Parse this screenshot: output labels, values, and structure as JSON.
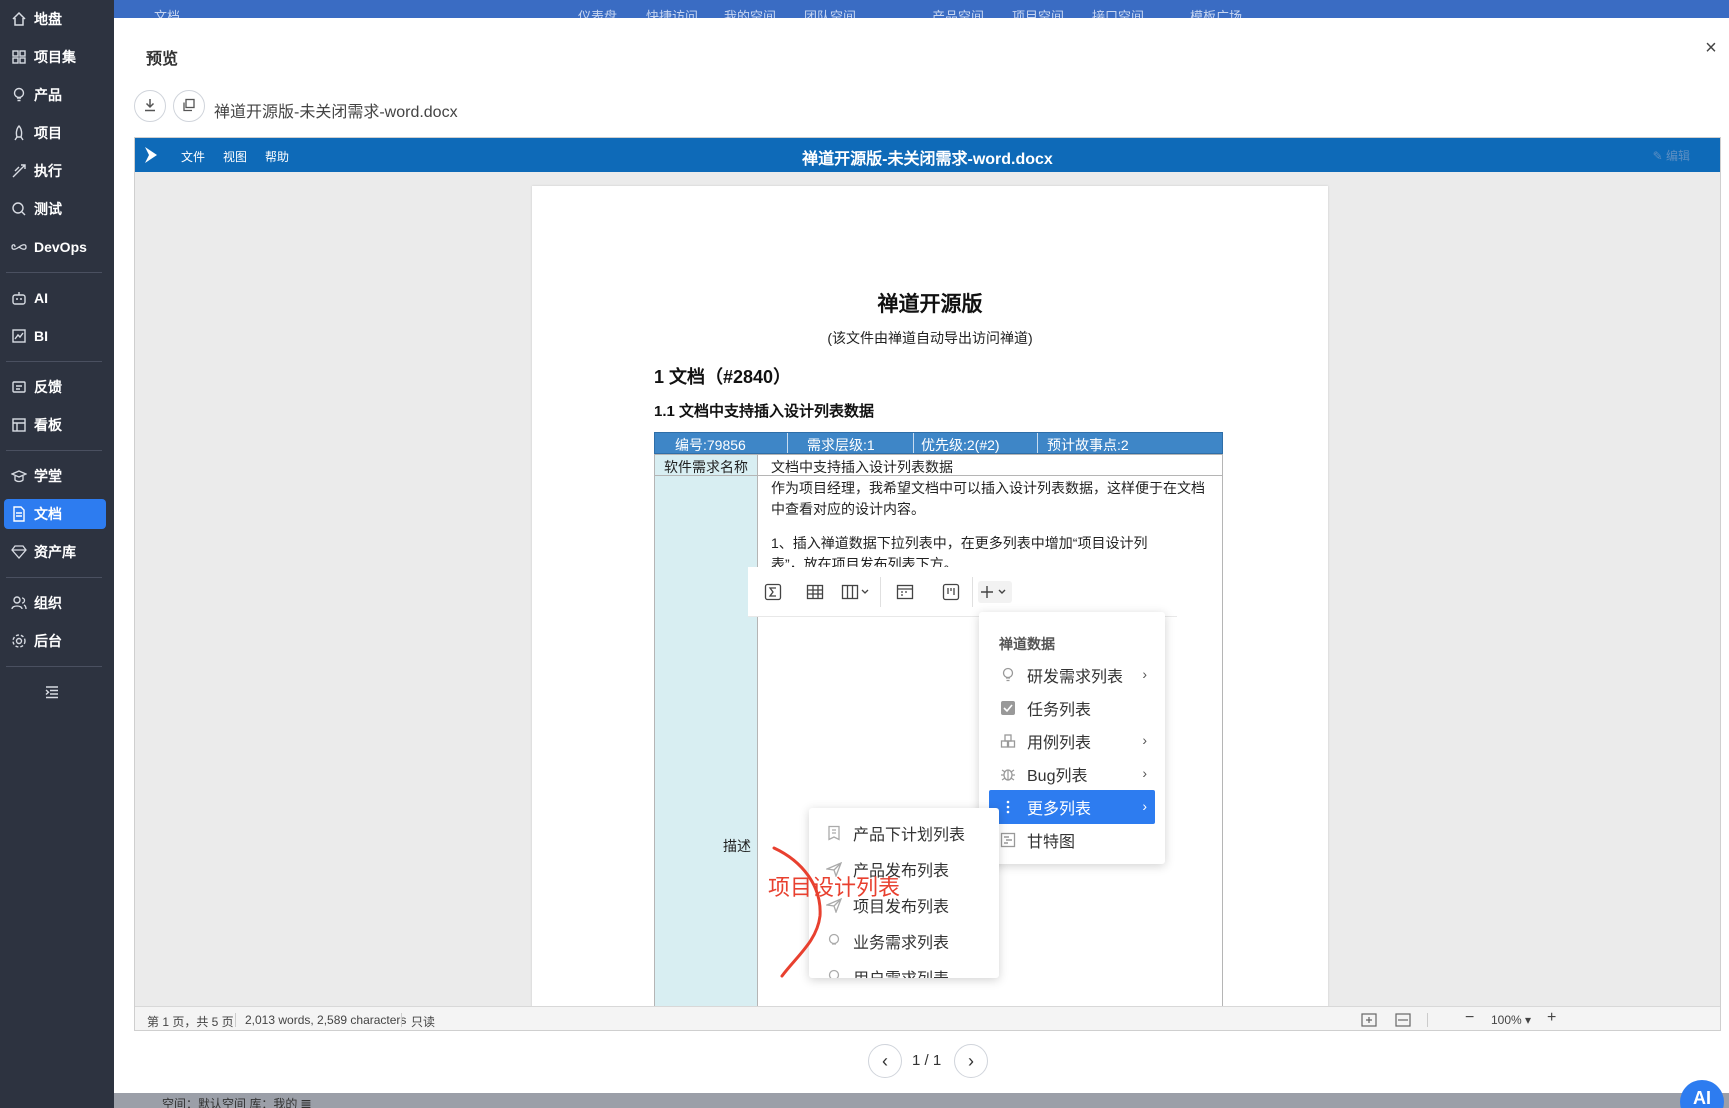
{
  "sidebar": {
    "items": [
      {
        "label": "地盘",
        "icon": "home-icon"
      },
      {
        "label": "项目集",
        "icon": "grid-icon"
      },
      {
        "label": "产品",
        "icon": "bulb-icon"
      },
      {
        "label": "项目",
        "icon": "rocket-icon"
      },
      {
        "label": "执行",
        "icon": "run-icon"
      },
      {
        "label": "测试",
        "icon": "search-icon"
      },
      {
        "label": "DevOps",
        "icon": "infinity-icon"
      },
      {
        "label": "AI",
        "icon": "robot-icon"
      },
      {
        "label": "BI",
        "icon": "chart-icon"
      },
      {
        "label": "反馈",
        "icon": "feedback-icon"
      },
      {
        "label": "看板",
        "icon": "kanban-icon"
      },
      {
        "label": "学堂",
        "icon": "school-icon"
      },
      {
        "label": "文档",
        "icon": "document-icon"
      },
      {
        "label": "资产库",
        "icon": "diamond-icon"
      },
      {
        "label": "组织",
        "icon": "people-icon"
      },
      {
        "label": "后台",
        "icon": "gear-icon"
      }
    ],
    "active": "文档",
    "collapse_icon": "indent-icon"
  },
  "topbar": {
    "items": [
      "文档",
      "仪表盘",
      "快捷访问",
      "我的空间",
      "团队空间",
      "产品空间",
      "项目空间",
      "接口空间",
      "模板广场"
    ]
  },
  "bottom_strip": {
    "text": "空间：默认空间 库：我的 𝌆"
  },
  "modal": {
    "title": "预览",
    "close_label": "×",
    "file_name": "禅道开源版-未关闭需求-word.docx"
  },
  "viewer": {
    "menus": [
      "文件",
      "视图",
      "帮助"
    ],
    "title": "禅道开源版-未关闭需求-word.docx",
    "edit_label": "编辑"
  },
  "document": {
    "title": "禅道开源版",
    "subtitle": "(该文件由禅道自动导出访问禅道)",
    "h1": "1 文档（#2840）",
    "h2": "1.1 文档中支持插入设计列表数据",
    "table": {
      "header": [
        "编号:79856",
        "需求层级:1",
        "优先级:2(#2)",
        "预计故事点:2"
      ],
      "name_label": "软件需求名称",
      "name_value": "文档中支持插入设计列表数据",
      "desc_label": "描述",
      "desc_paragraphs": [
        "作为项目经理，我希望文档中可以插入设计列表数据，这样便于在文档中查看对应的设计内容。",
        "1、插入禅道数据下拉列表中，在更多列表中增加“项目设计列表”，放在项目发布列表下方。"
      ]
    },
    "embed": {
      "dropdown_header": "禅道数据",
      "dropdown_items": [
        {
          "label": "研发需求列表",
          "icon": "bulb-icon",
          "has_sub": true,
          "selected": false
        },
        {
          "label": "任务列表",
          "icon": "checkbox-icon",
          "has_sub": false,
          "selected": false
        },
        {
          "label": "用例列表",
          "icon": "case-icon",
          "has_sub": true,
          "selected": false
        },
        {
          "label": "Bug列表",
          "icon": "bug-icon",
          "has_sub": true,
          "selected": false
        },
        {
          "label": "更多列表",
          "icon": "more-vertical-icon",
          "has_sub": true,
          "selected": true
        },
        {
          "label": "甘特图",
          "icon": "gantt-icon",
          "has_sub": false,
          "selected": false
        }
      ],
      "sub_items": [
        {
          "label": "产品下计划列表",
          "icon": "plan-icon"
        },
        {
          "label": "产品发布列表",
          "icon": "send-icon"
        },
        {
          "label": "项目发布列表",
          "icon": "send-icon"
        },
        {
          "label": "业务需求列表",
          "icon": "bulb-icon"
        },
        {
          "label": "用户需求列表",
          "icon": "bulb-icon"
        }
      ],
      "annotation": "项目设计列表"
    }
  },
  "status_bar": {
    "page_info": "第 1 页，共 5 页",
    "word_count": "2,013 words, 2,589 characters",
    "mode": "只读",
    "zoom": "100%",
    "zoom_out": "−",
    "zoom_in": "+"
  },
  "pager": {
    "label": "1 / 1"
  },
  "ai_button": {
    "label": "AI"
  },
  "colors": {
    "sidebar": "#2d3340",
    "accent": "#2d7cf0",
    "viewer_header": "#0e6ab8",
    "annotation": "#e8402f"
  }
}
